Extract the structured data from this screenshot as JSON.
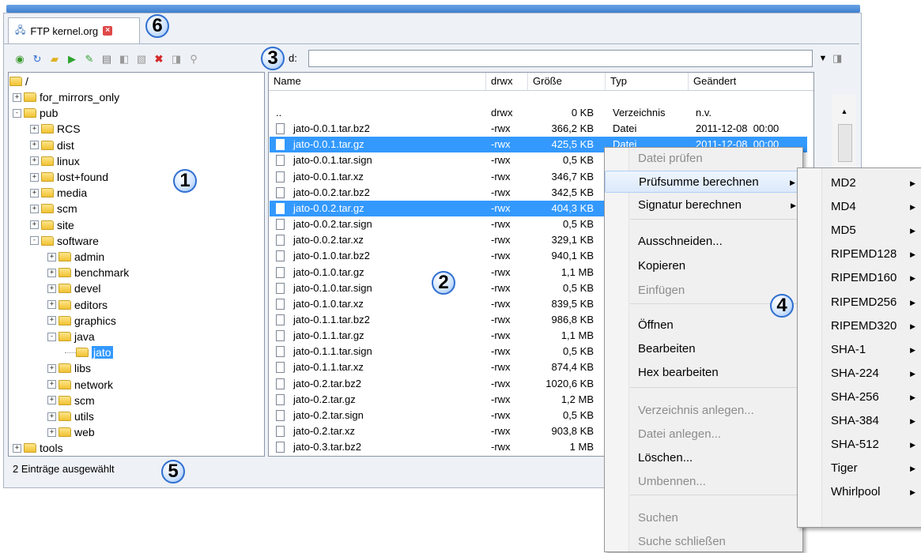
{
  "tab": {
    "title": "FTP kernel.org"
  },
  "toolbar": {
    "icons": [
      "connect-icon",
      "refresh-icon",
      "new-folder-icon",
      "play-icon",
      "edit-icon",
      "properties-icon",
      "disconnect-icon",
      "view-icon",
      "delete-icon",
      "upload-icon",
      "search-icon"
    ]
  },
  "path": {
    "label": "d:",
    "value": ""
  },
  "tree": {
    "root": "/",
    "items": [
      {
        "label": "for_mirrors_only"
      },
      {
        "label": "pub"
      },
      {
        "label": "RCS"
      },
      {
        "label": "dist"
      },
      {
        "label": "linux"
      },
      {
        "label": "lost+found"
      },
      {
        "label": "media"
      },
      {
        "label": "scm"
      },
      {
        "label": "site"
      },
      {
        "label": "software"
      },
      {
        "label": "admin"
      },
      {
        "label": "benchmark"
      },
      {
        "label": "devel"
      },
      {
        "label": "editors"
      },
      {
        "label": "graphics"
      },
      {
        "label": "java"
      },
      {
        "label": "jato"
      },
      {
        "label": "libs"
      },
      {
        "label": "network"
      },
      {
        "label": "scm"
      },
      {
        "label": "utils"
      },
      {
        "label": "web"
      },
      {
        "label": "tools"
      }
    ]
  },
  "files": {
    "columns": {
      "name": "Name",
      "perm": "drwx",
      "size": "Größe",
      "type": "Typ",
      "changed": "Geändert"
    },
    "rows": [
      {
        "name": "..",
        "perm": "drwx",
        "size": "0 KB",
        "type": "Verzeichnis",
        "changed": "n.v."
      },
      {
        "name": "jato-0.0.1.tar.bz2",
        "perm": "-rwx",
        "size": "366,2 KB",
        "type": "Datei",
        "changed": "2011-12-08  00:00"
      },
      {
        "name": "jato-0.0.1.tar.gz",
        "perm": "-rwx",
        "size": "425,5 KB",
        "type": "Datei",
        "changed": "2011-12-08  00:00"
      },
      {
        "name": "jato-0.0.1.tar.sign",
        "perm": "-rwx",
        "size": "0,5 KB",
        "type": "",
        "changed": ""
      },
      {
        "name": "jato-0.0.1.tar.xz",
        "perm": "-rwx",
        "size": "346,7 KB",
        "type": "",
        "changed": ""
      },
      {
        "name": "jato-0.0.2.tar.bz2",
        "perm": "-rwx",
        "size": "342,5 KB",
        "type": "",
        "changed": ""
      },
      {
        "name": "jato-0.0.2.tar.gz",
        "perm": "-rwx",
        "size": "404,3 KB",
        "type": "",
        "changed": ""
      },
      {
        "name": "jato-0.0.2.tar.sign",
        "perm": "-rwx",
        "size": "0,5 KB",
        "type": "",
        "changed": ""
      },
      {
        "name": "jato-0.0.2.tar.xz",
        "perm": "-rwx",
        "size": "329,1 KB",
        "type": "",
        "changed": ""
      },
      {
        "name": "jato-0.1.0.tar.bz2",
        "perm": "-rwx",
        "size": "940,1 KB",
        "type": "",
        "changed": ""
      },
      {
        "name": "jato-0.1.0.tar.gz",
        "perm": "-rwx",
        "size": "1,1 MB",
        "type": "",
        "changed": ""
      },
      {
        "name": "jato-0.1.0.tar.sign",
        "perm": "-rwx",
        "size": "0,5 KB",
        "type": "",
        "changed": ""
      },
      {
        "name": "jato-0.1.0.tar.xz",
        "perm": "-rwx",
        "size": "839,5 KB",
        "type": "",
        "changed": ""
      },
      {
        "name": "jato-0.1.1.tar.bz2",
        "perm": "-rwx",
        "size": "986,8 KB",
        "type": "",
        "changed": ""
      },
      {
        "name": "jato-0.1.1.tar.gz",
        "perm": "-rwx",
        "size": "1,1 MB",
        "type": "",
        "changed": ""
      },
      {
        "name": "jato-0.1.1.tar.sign",
        "perm": "-rwx",
        "size": "0,5 KB",
        "type": "",
        "changed": ""
      },
      {
        "name": "jato-0.1.1.tar.xz",
        "perm": "-rwx",
        "size": "874,4 KB",
        "type": "",
        "changed": ""
      },
      {
        "name": "jato-0.2.tar.bz2",
        "perm": "-rwx",
        "size": "1020,6 KB",
        "type": "",
        "changed": ""
      },
      {
        "name": "jato-0.2.tar.gz",
        "perm": "-rwx",
        "size": "1,2 MB",
        "type": "",
        "changed": ""
      },
      {
        "name": "jato-0.2.tar.sign",
        "perm": "-rwx",
        "size": "0,5 KB",
        "type": "",
        "changed": ""
      },
      {
        "name": "jato-0.2.tar.xz",
        "perm": "-rwx",
        "size": "903,8 KB",
        "type": "",
        "changed": ""
      },
      {
        "name": "jato-0.3.tar.bz2",
        "perm": "-rwx",
        "size": "1 MB",
        "type": "",
        "changed": ""
      }
    ]
  },
  "status": {
    "text": "2 Einträge ausgewählt"
  },
  "context_menu": {
    "items": [
      {
        "label": "Datei prüfen",
        "disabled": true
      },
      {
        "label": "Prüfsumme berechnen",
        "submenu": true
      },
      {
        "label": "Signatur berechnen",
        "submenu": true
      },
      {
        "label": "Ausschneiden..."
      },
      {
        "label": "Kopieren"
      },
      {
        "label": "Einfügen",
        "disabled": true
      },
      {
        "label": "Öffnen"
      },
      {
        "label": "Bearbeiten"
      },
      {
        "label": "Hex bearbeiten"
      },
      {
        "label": "Verzeichnis anlegen...",
        "disabled": true
      },
      {
        "label": "Datei anlegen...",
        "disabled": true
      },
      {
        "label": "Löschen..."
      },
      {
        "label": "Umbennen...",
        "disabled": true
      },
      {
        "label": "Suchen",
        "disabled": true
      },
      {
        "label": "Suche schließen",
        "disabled": true
      }
    ]
  },
  "submenu": {
    "items": [
      "MD2",
      "MD4",
      "MD5",
      "RIPEMD128",
      "RIPEMD160",
      "RIPEMD256",
      "RIPEMD320",
      "SHA-1",
      "SHA-224",
      "SHA-256",
      "SHA-384",
      "SHA-512",
      "Tiger",
      "Whirlpool"
    ]
  },
  "badges": [
    "1",
    "2",
    "3",
    "4",
    "5",
    "6"
  ]
}
